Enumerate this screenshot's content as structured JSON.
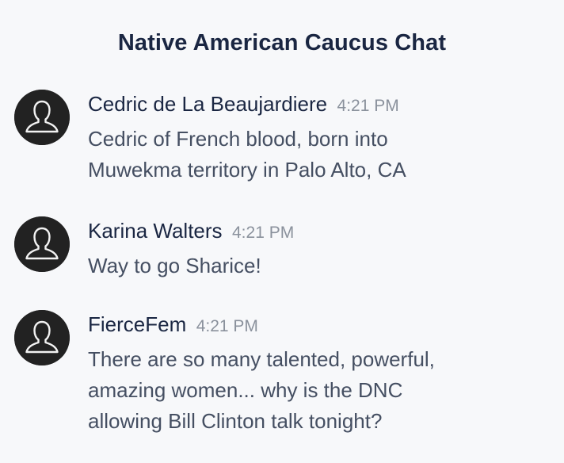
{
  "chat": {
    "title": "Native American Caucus Chat"
  },
  "messages": [
    {
      "author": "Cedric de La Beaujardiere",
      "time": "4:21 PM",
      "lines": [
        "Cedric of French blood, born into",
        "Muwekma territory in Palo Alto, CA"
      ],
      "avatar_icon": "user-silhouette-icon"
    },
    {
      "author": "Karina Walters",
      "time": "4:21 PM",
      "lines": [
        "Way to go Sharice!"
      ],
      "avatar_icon": "user-silhouette-icon"
    },
    {
      "author": "FierceFem",
      "time": "4:21 PM",
      "lines": [
        "There are so many talented, powerful,",
        "amazing women... why is the DNC",
        "allowing Bill Clinton talk tonight?"
      ],
      "avatar_icon": "user-silhouette-icon"
    }
  ],
  "colors": {
    "background": "#f7f8fa",
    "title": "#1a2642",
    "author": "#1a2642",
    "body_text": "#454f62",
    "timestamp": "#8a919c",
    "avatar": "#222222"
  }
}
